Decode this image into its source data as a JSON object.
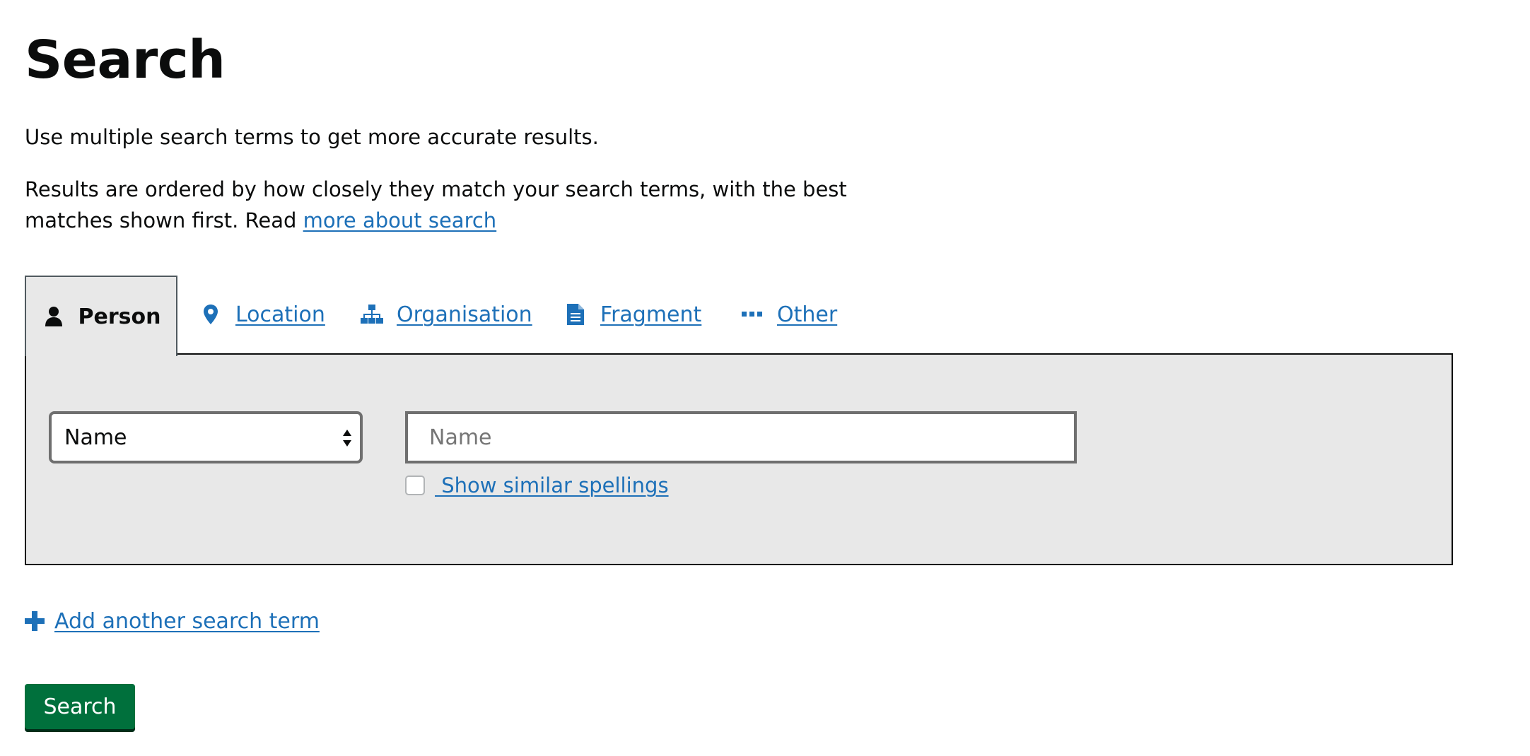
{
  "page": {
    "title": "Search",
    "intro_line": "Use multiple search terms to get more accurate results.",
    "ordering_text": "Results are ordered by how closely they match your search terms, with the best matches shown first. Read ",
    "more_about_link": "more about search"
  },
  "tabs": [
    {
      "label": "Person",
      "icon": "person-icon",
      "selected": true
    },
    {
      "label": "Location",
      "icon": "map-pin-icon",
      "selected": false
    },
    {
      "label": "Organisation",
      "icon": "org-chart-icon",
      "selected": false
    },
    {
      "label": "Fragment",
      "icon": "document-icon",
      "selected": false
    },
    {
      "label": "Other",
      "icon": "ellipsis-icon",
      "selected": false
    }
  ],
  "panel": {
    "field_select": {
      "selected": "Name"
    },
    "term_input": {
      "value": "",
      "placeholder": "Name"
    },
    "similar_spellings": {
      "label": " Show similar spellings",
      "checked": false
    }
  },
  "actions": {
    "add_term_label": "Add another search term",
    "search_button_label": "Search"
  },
  "colors": {
    "link": "#1d70b8",
    "panel_background": "#e8e8e8",
    "button_green": "#00703c",
    "text": "#0b0c0c"
  }
}
